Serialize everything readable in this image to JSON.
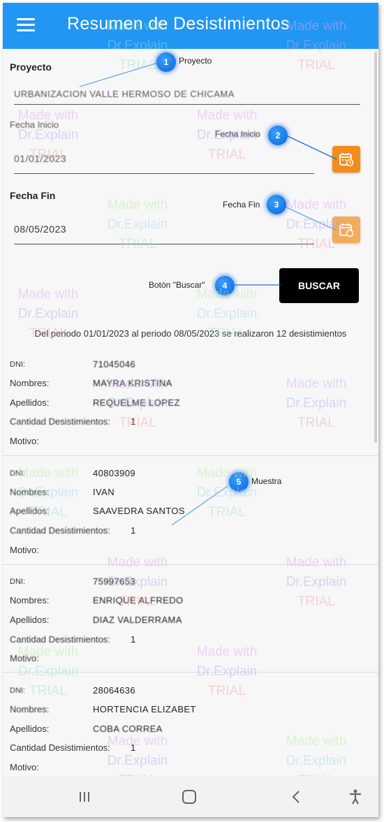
{
  "app": {
    "title": "Resumen de Desistimientos"
  },
  "form": {
    "proyecto_label": "Proyecto",
    "proyecto_value": "URBANIZACION VALLE HERMOSO DE CHICAMA",
    "fecha_inicio_label": "Fecha Inicio",
    "fecha_inicio_value": "01/01/2023",
    "fecha_fin_label": "Fecha Fin",
    "fecha_fin_value": "08/05/2023",
    "buscar_label": "BUSCAR"
  },
  "summary": "Del periodo 01/01/2023 al periodo 08/05/2023 se realizaron 12 desistimientos",
  "field_labels": {
    "dni": "DNI:",
    "nombres": "Nombres:",
    "apellidos": "Apellidos:",
    "cantidad": "Cantidad Desistimientos:",
    "motivo": "Motivo:"
  },
  "records": [
    {
      "dni": "71045046",
      "nombres": "MAYRA KRISTINA",
      "apellidos": "REQUELME LOPEZ",
      "cantidad": "1",
      "motivo": ""
    },
    {
      "dni": "40803909",
      "nombres": "IVAN",
      "apellidos": "SAAVEDRA SANTOS",
      "cantidad": "1",
      "motivo": ""
    },
    {
      "dni": "75997653",
      "nombres": "ENRIQUE ALFREDO",
      "apellidos": "DIAZ VALDERRAMA",
      "cantidad": "1",
      "motivo": ""
    },
    {
      "dni": "28064636",
      "nombres": "HORTENCIA ELIZABET",
      "apellidos": "COBA CORREA",
      "cantidad": "1",
      "motivo": ""
    }
  ],
  "callouts": [
    {
      "number": "1",
      "text": "Proyecto"
    },
    {
      "number": "2",
      "text": "Fecha Inicio"
    },
    {
      "number": "3",
      "text": "Fecha Fin"
    },
    {
      "number": "4",
      "text": "Botón \"Buscar\""
    },
    {
      "number": "5",
      "text": "Muestra"
    }
  ],
  "watermark": {
    "line1": "Made with",
    "line2": "Dr.Explain",
    "line3": "TRIAL"
  },
  "nav_icons": [
    "recent-apps-icon",
    "home-icon",
    "back-icon",
    "accessibility-icon"
  ],
  "colors": {
    "appbar": "#2196f3",
    "calendar_button": "#f28c1b",
    "search_button": "#000000",
    "marker": "#0a63d8"
  }
}
